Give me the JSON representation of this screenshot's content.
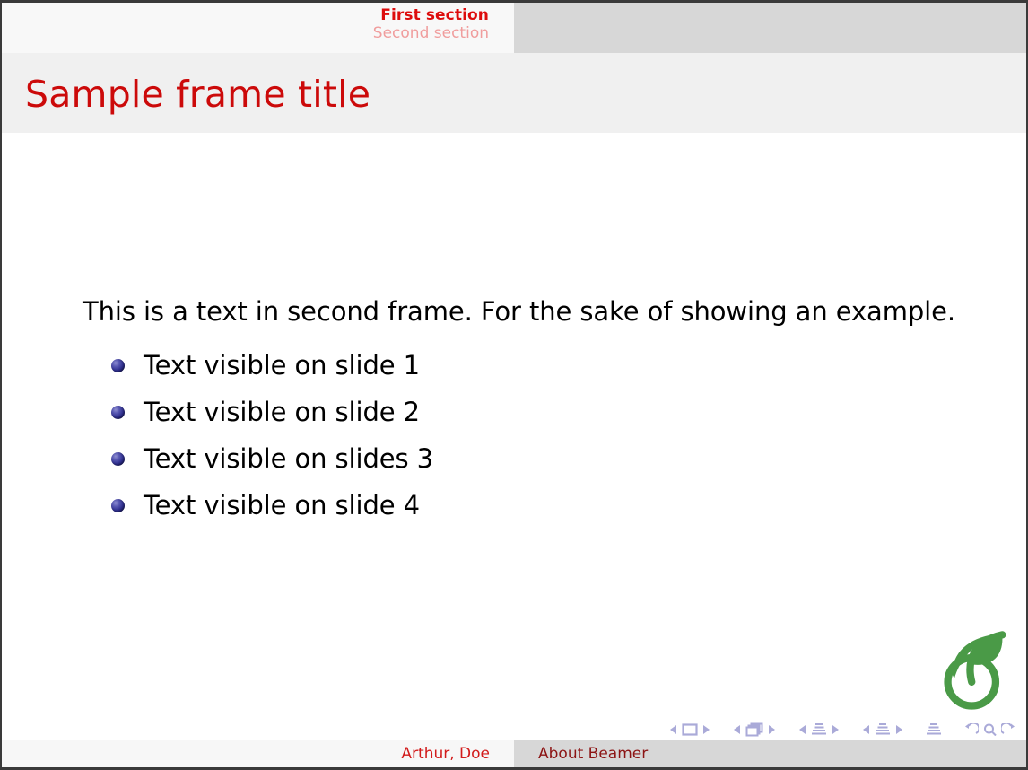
{
  "navbar": {
    "sections": [
      {
        "label": "First section",
        "state": "current"
      },
      {
        "label": "Second section",
        "state": "other"
      }
    ]
  },
  "frame": {
    "title": "Sample frame title",
    "lead_text": "This is a text in second frame.  For the sake of showing an example.",
    "bullets": [
      {
        "label": "Text visible on slide 1"
      },
      {
        "label": "Text visible on slide 2"
      },
      {
        "label": "Text visible on slides 3"
      },
      {
        "label": "Text visible on slide 4"
      }
    ]
  },
  "footer": {
    "author": "Arthur, Doe",
    "short_title": "About Beamer"
  },
  "logo": {
    "name": "overleaf-logo",
    "color": "#4a9a47"
  },
  "nav_symbols": {
    "items": [
      "prev-slide-arrow",
      "slide-icon",
      "next-slide-arrow",
      "prev-frame-arrow",
      "frame-icon",
      "next-frame-arrow",
      "prev-subsection-arrow",
      "subsection-icon",
      "next-subsection-arrow",
      "prev-section-arrow",
      "section-icon",
      "next-section-arrow",
      "presentation-icon",
      "back-icon",
      "search-icon",
      "forward-icon"
    ],
    "color": "#aaaad8"
  },
  "theme": {
    "title_color": "#cc0a0a",
    "current_section_color": "#dd0c0c",
    "other_section_color": "#f09d9d",
    "bullet_color": "#2f2f8e",
    "header_left_bg": "#f8f8f8",
    "header_right_bg": "#d7d7d7",
    "title_band_bg": "#f0f0f0",
    "body_bg": "#ffffff"
  }
}
